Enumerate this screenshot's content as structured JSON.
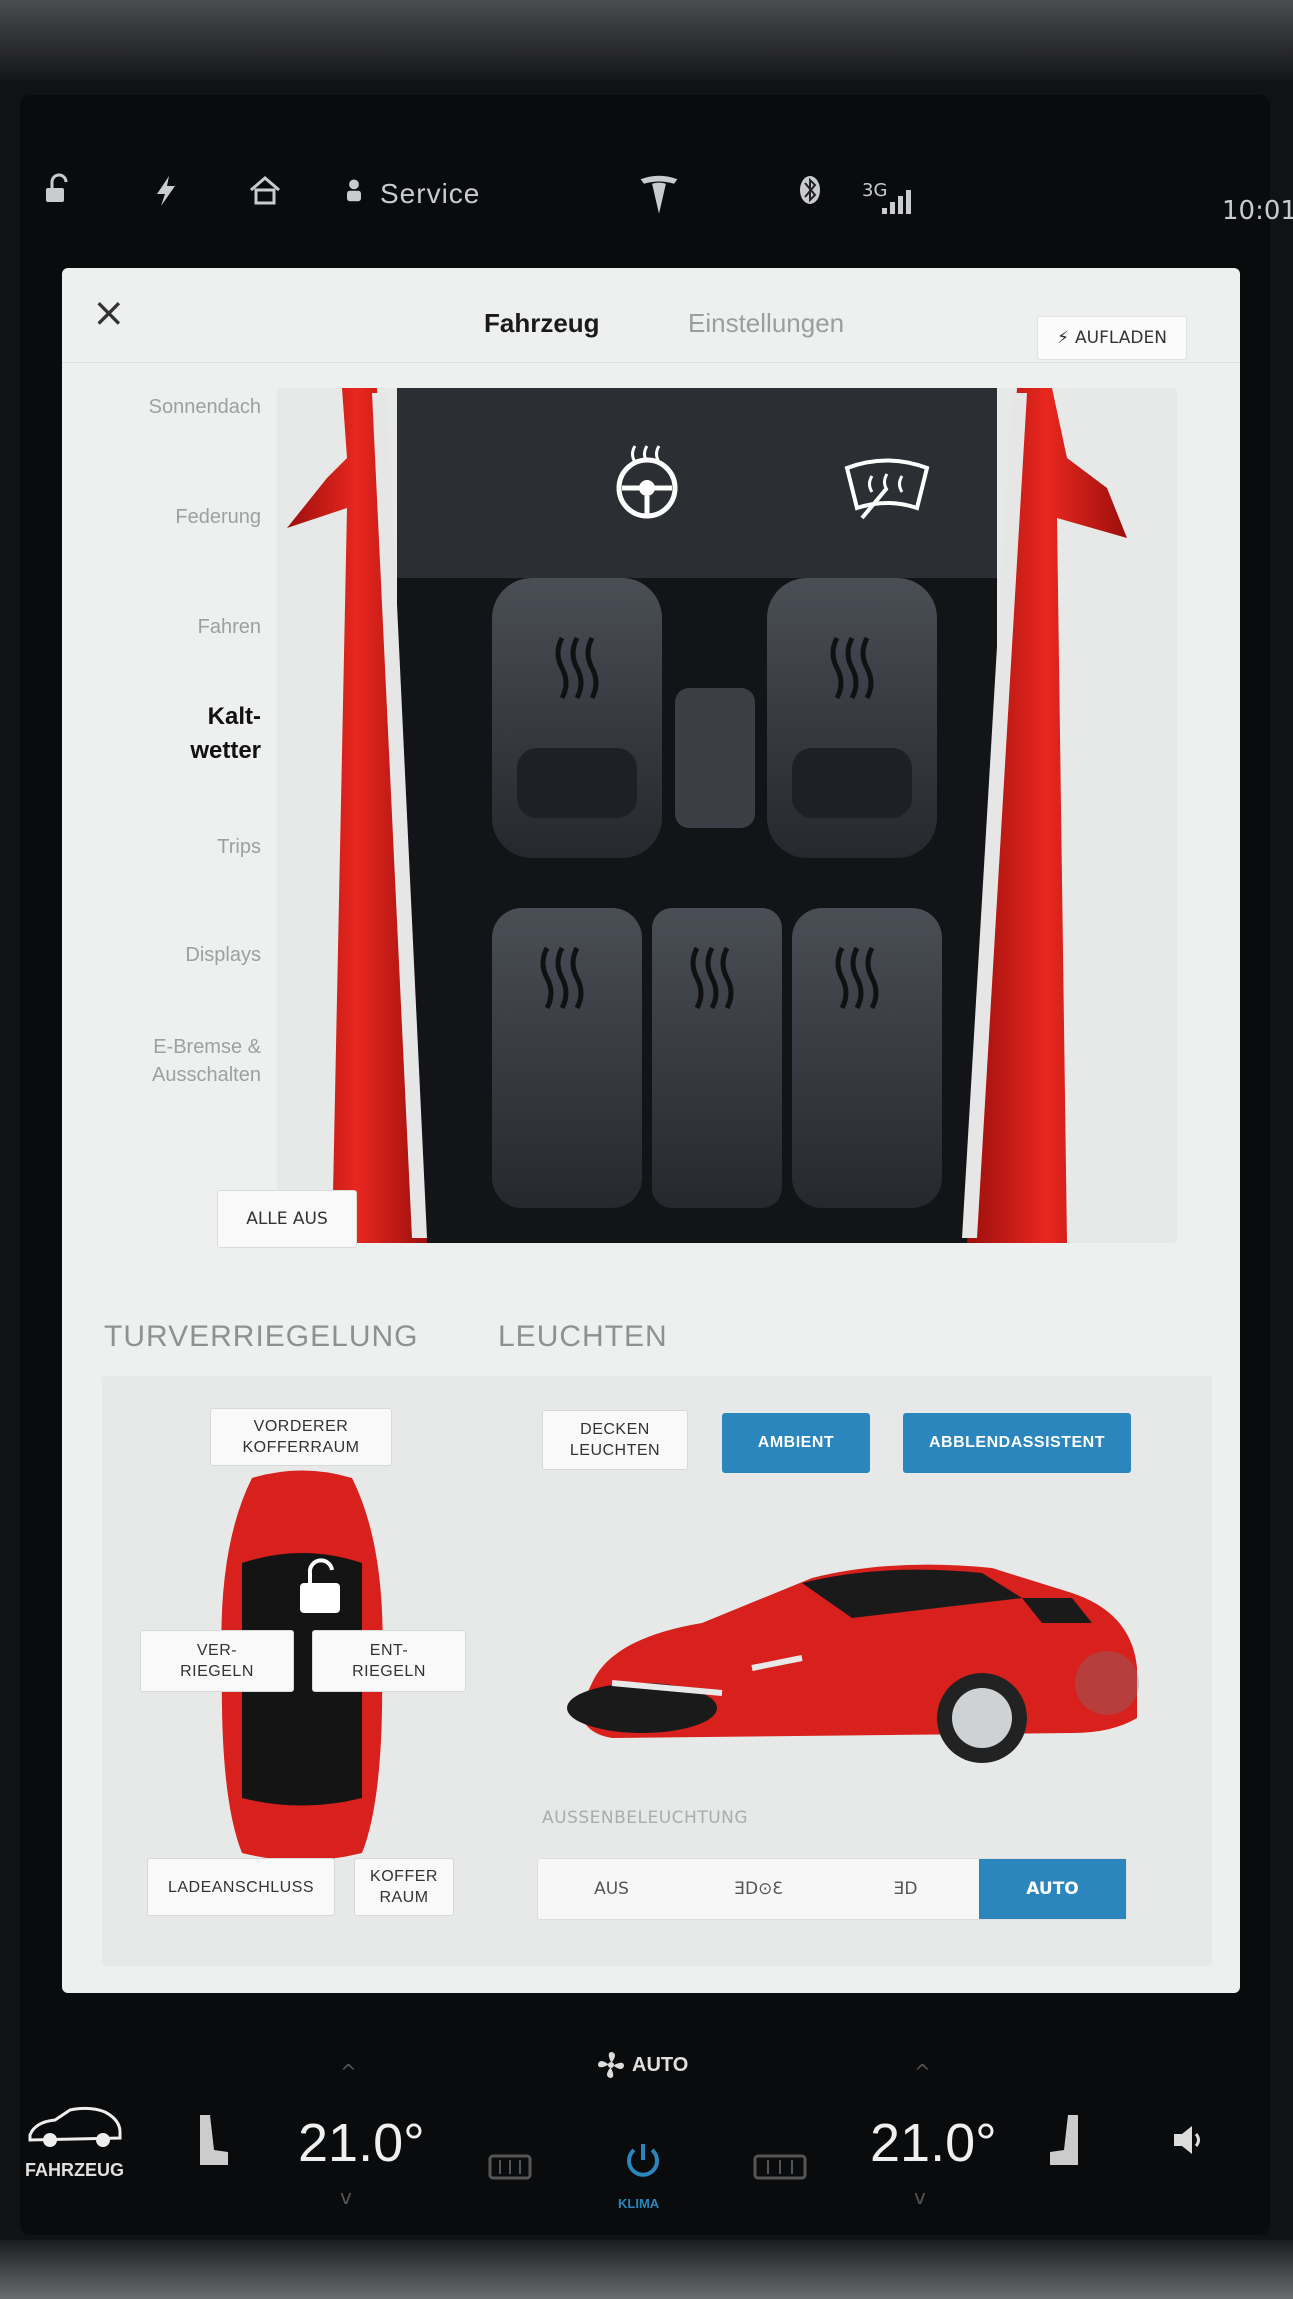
{
  "status_bar": {
    "service_label": "Service",
    "network": "3G",
    "clock": "10:01",
    "icons": [
      "lock-open-icon",
      "lightning-icon",
      "home-icon",
      "person-icon",
      "tesla-logo-icon",
      "bluetooth-icon",
      "signal-icon"
    ]
  },
  "modal": {
    "close": "×",
    "tabs": [
      {
        "label": "Fahrzeug",
        "active": true
      },
      {
        "label": "Einstellungen",
        "active": false
      }
    ],
    "charge_button": "AUFLADEN",
    "sidebar": [
      {
        "label": "Sonnendach",
        "active": false
      },
      {
        "label": "Federung",
        "active": false
      },
      {
        "label": "Fahren",
        "active": false
      },
      {
        "label": "Kalt-\nwetter",
        "active": true
      },
      {
        "label": "Trips",
        "active": false
      },
      {
        "label": "Displays",
        "active": false
      },
      {
        "label": "E-Bremse &\nAusschalten",
        "active": false
      }
    ],
    "cabin": {
      "all_off_button": "ALLE AUS",
      "icons": [
        "heated-steering-wheel-icon",
        "wiper-defrost-icon",
        "seat-heater-icon"
      ]
    },
    "sections": {
      "locks_title": "TURVERRIEGELUNG",
      "lights_title": "LEUCHTEN"
    },
    "locks": {
      "front_trunk": "VORDERER\nKOFFERRAUM",
      "lock": "VER-\nRIEGELN",
      "unlock": "ENT-\nRIEGELN",
      "charge_port": "LADEANSCHLUSS",
      "trunk": "KOFFER\nRAUM"
    },
    "lights": {
      "dome": "DECKEN\nLEUCHTEN",
      "ambient": "AMBIENT",
      "high_beam_assist": "ABBLENDASSISTENT",
      "exterior_label": "AUSSENBELEUCHTUNG",
      "modes": [
        {
          "label": "AUS",
          "active": false
        },
        {
          "label": "ƎD⊙Ɛ",
          "active": false
        },
        {
          "label": "ƎD",
          "active": false
        },
        {
          "label": "AUTO",
          "active": true
        }
      ]
    }
  },
  "climate": {
    "vehicle_label": "FAHRZEUG",
    "fan_mode": "AUTO",
    "left_temp": "21.0°",
    "right_temp": "21.0°",
    "climate_label": "KLIMA"
  },
  "colors": {
    "accent_blue": "#2a86bd",
    "car_red": "#d8201c",
    "panel_bg": "#edf0ee"
  }
}
